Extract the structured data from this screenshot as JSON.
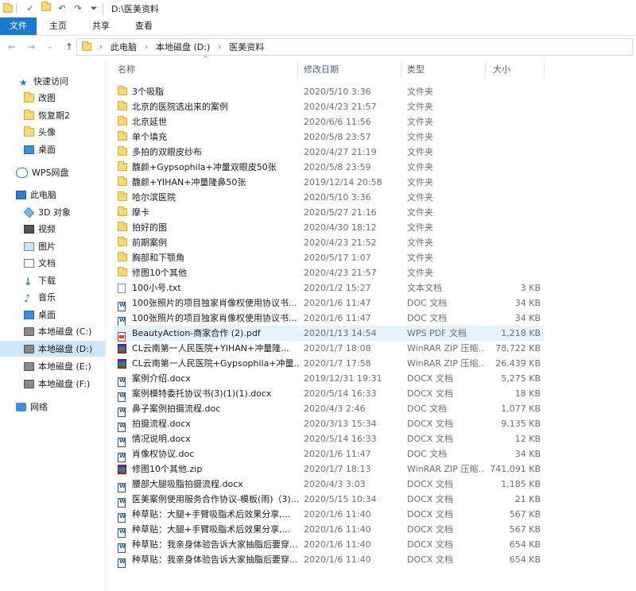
{
  "window": {
    "title": "D:\\医美资料"
  },
  "ribbon": {
    "tabs": [
      "文件",
      "主页",
      "共享",
      "查看"
    ],
    "active": 0
  },
  "address": {
    "crumbs": [
      "此电脑",
      "本地磁盘 (D:)",
      "医美资料"
    ]
  },
  "sidebar": {
    "items": [
      {
        "label": "快速访问",
        "icon": "star-icon"
      },
      {
        "label": "改图",
        "icon": "folder-icon"
      },
      {
        "label": "恢复期2",
        "icon": "folder-icon"
      },
      {
        "label": "头像",
        "icon": "folder-icon"
      },
      {
        "label": "桌面",
        "icon": "desktop-icon"
      },
      {
        "label": "WPS网盘",
        "icon": "cloud-icon"
      },
      {
        "label": "此电脑",
        "icon": "computer-icon"
      },
      {
        "label": "3D 对象",
        "icon": "3d-objects-icon"
      },
      {
        "label": "视频",
        "icon": "video-icon"
      },
      {
        "label": "图片",
        "icon": "pictures-icon"
      },
      {
        "label": "文档",
        "icon": "documents-icon"
      },
      {
        "label": "下载",
        "icon": "download-icon"
      },
      {
        "label": "音乐",
        "icon": "music-icon"
      },
      {
        "label": "桌面",
        "icon": "desktop-icon"
      },
      {
        "label": "本地磁盘 (C:)",
        "icon": "drive-icon"
      },
      {
        "label": "本地磁盘 (D:)",
        "icon": "drive-icon"
      },
      {
        "label": "本地磁盘 (E:)",
        "icon": "drive-icon"
      },
      {
        "label": "本地磁盘 (F:)",
        "icon": "drive-icon"
      },
      {
        "label": "网络",
        "icon": "network-icon"
      }
    ],
    "selected": 15
  },
  "columns": {
    "name": "名称",
    "date": "修改日期",
    "type": "类型",
    "size": "大小"
  },
  "files": [
    {
      "name": "3个吸脂",
      "date": "2020/5/10 3:36",
      "type": "文件夹",
      "size": "",
      "icon": "folder"
    },
    {
      "name": "北京的医院选出来的案例",
      "date": "2020/4/23 21:57",
      "type": "文件夹",
      "size": "",
      "icon": "folder"
    },
    {
      "name": "北京延世",
      "date": "2020/6/6 11:56",
      "type": "文件夹",
      "size": "",
      "icon": "folder"
    },
    {
      "name": "单个填充",
      "date": "2020/5/8 23:57",
      "type": "文件夹",
      "size": "",
      "icon": "folder"
    },
    {
      "name": "多拍的双眼皮纱布",
      "date": "2020/4/27 21:19",
      "type": "文件夹",
      "size": "",
      "icon": "folder"
    },
    {
      "name": "馥颜+Gypsophila+冲量双眼皮50张",
      "date": "2020/5/8 23:59",
      "type": "文件夹",
      "size": "",
      "icon": "folder"
    },
    {
      "name": "馥颜+YIHAN+冲量隆鼻50张",
      "date": "2019/12/14 20:58",
      "type": "文件夹",
      "size": "",
      "icon": "folder"
    },
    {
      "name": "哈尔滨医院",
      "date": "2020/5/10 3:36",
      "type": "文件夹",
      "size": "",
      "icon": "folder"
    },
    {
      "name": "摩卡",
      "date": "2020/5/27 21:16",
      "type": "文件夹",
      "size": "",
      "icon": "folder"
    },
    {
      "name": "拍好的图",
      "date": "2020/4/30 18:12",
      "type": "文件夹",
      "size": "",
      "icon": "folder"
    },
    {
      "name": "前期案例",
      "date": "2020/4/23 21:52",
      "type": "文件夹",
      "size": "",
      "icon": "folder"
    },
    {
      "name": "胸部和下颚角",
      "date": "2020/5/17 1:07",
      "type": "文件夹",
      "size": "",
      "icon": "folder"
    },
    {
      "name": "修图10个其他",
      "date": "2020/4/23 21:57",
      "type": "文件夹",
      "size": "",
      "icon": "folder"
    },
    {
      "name": "100小号.txt",
      "date": "2020/1/2 15:27",
      "type": "文本文档",
      "size": "3 KB",
      "icon": "txt"
    },
    {
      "name": "100张照片的项目独家肖像权使用协议书...",
      "date": "2020/1/6 11:47",
      "type": "DOC 文档",
      "size": "34 KB",
      "icon": "doc"
    },
    {
      "name": "100张照片的项目独家肖像权使用协议书...",
      "date": "2020/1/6 11:47",
      "type": "DOC 文档",
      "size": "34 KB",
      "icon": "doc"
    },
    {
      "name": "BeautyAction-商家合作 (2).pdf",
      "date": "2020/1/13 14:54",
      "type": "WPS PDF 文档",
      "size": "1,218 KB",
      "icon": "pdf"
    },
    {
      "name": "CL云南第一人民医院+YIHAN+冲量隆...",
      "date": "2020/1/7 18:08",
      "type": "WinRAR ZIP 压缩...",
      "size": "78,722 KB",
      "icon": "zip"
    },
    {
      "name": "CL云南第一人民医院+Gypsophila+冲量...",
      "date": "2020/1/7 17:58",
      "type": "WinRAR ZIP 压缩...",
      "size": "26,439 KB",
      "icon": "zip"
    },
    {
      "name": "案例介绍.docx",
      "date": "2019/12/31 19:31",
      "type": "DOCX 文档",
      "size": "5,275 KB",
      "icon": "doc"
    },
    {
      "name": "案例模特委托协议书(3)(1)(1).docx",
      "date": "2020/5/14 16:33",
      "type": "DOCX 文档",
      "size": "18 KB",
      "icon": "doc"
    },
    {
      "name": "鼻子案例拍摄流程.doc",
      "date": "2020/4/3 2:46",
      "type": "DOC 文档",
      "size": "1,077 KB",
      "icon": "doc"
    },
    {
      "name": "拍摄流程.docx",
      "date": "2020/3/13 15:34",
      "type": "DOCX 文档",
      "size": "9,135 KB",
      "icon": "doc"
    },
    {
      "name": "情况说明.docx",
      "date": "2020/5/14 16:33",
      "type": "DOCX 文档",
      "size": "12 KB",
      "icon": "doc"
    },
    {
      "name": "肖像权协议.doc",
      "date": "2020/1/6 11:47",
      "type": "DOC 文档",
      "size": "34 KB",
      "icon": "doc"
    },
    {
      "name": "修图10个其他.zip",
      "date": "2020/1/7 18:13",
      "type": "WinRAR ZIP 压缩...",
      "size": "741,091 KB",
      "icon": "zip"
    },
    {
      "name": "腰部大腿吸脂拍摄流程.docx",
      "date": "2020/4/3 3:03",
      "type": "DOCX 文档",
      "size": "1,185 KB",
      "icon": "doc"
    },
    {
      "name": "医美案例使用服务合作协议-模板(雨)（3)...",
      "date": "2020/5/15 10:34",
      "type": "DOCX 文档",
      "size": "21 KB",
      "icon": "doc"
    },
    {
      "name": "种草贴：大腿+手臂吸脂术后效果分享,...",
      "date": "2020/1/6 11:40",
      "type": "DOCX 文档",
      "size": "567 KB",
      "icon": "doc"
    },
    {
      "name": "种草贴：大腿+手臂吸脂术后效果分享,...",
      "date": "2020/1/6 11:40",
      "type": "DOCX 文档",
      "size": "567 KB",
      "icon": "doc"
    },
    {
      "name": "种草贴：我亲身体验告诉大家抽脂后要穿...",
      "date": "2020/1/6 11:40",
      "type": "DOCX 文档",
      "size": "654 KB",
      "icon": "doc"
    },
    {
      "name": "种草贴：我亲身体验告诉大家抽脂后要穿...",
      "date": "2020/1/6 11:40",
      "type": "DOCX 文档",
      "size": "654 KB",
      "icon": "doc"
    }
  ],
  "hovered_row": 16
}
